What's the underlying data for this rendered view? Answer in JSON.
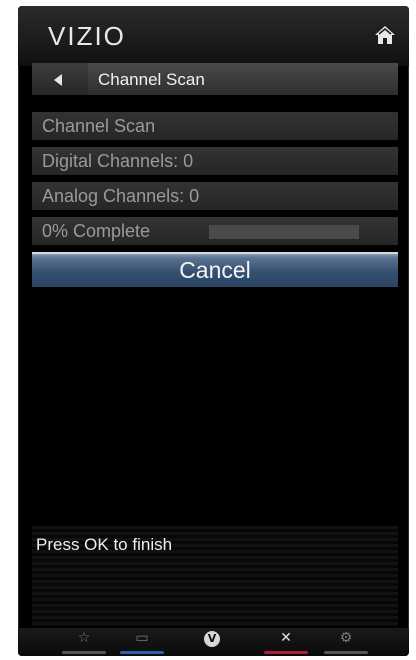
{
  "brand": {
    "logo": "VIZIO"
  },
  "header": {
    "title": "Channel Scan"
  },
  "scan": {
    "heading": "Channel Scan",
    "digital_channels": "Digital Channels: 0",
    "analog_channels": "Analog Channels: 0",
    "progress_label": "0% Complete",
    "progress_fraction": 0
  },
  "actions": {
    "cancel_label": "Cancel"
  },
  "hint": {
    "text": "Press OK to finish"
  },
  "bottom_bar": {
    "buttons": [
      {
        "icon": "star-icon",
        "glyph": "☆",
        "color": "#555555"
      },
      {
        "icon": "screen-icon",
        "glyph": "▭",
        "color": "#2f5fa8"
      },
      {
        "icon": "vizio-v-icon",
        "glyph": "V",
        "color": "#000000"
      },
      {
        "icon": "close-icon",
        "glyph": "✕",
        "color": "#b01e3a"
      },
      {
        "icon": "gear-icon",
        "glyph": "⚙",
        "color": "#555555"
      }
    ]
  }
}
